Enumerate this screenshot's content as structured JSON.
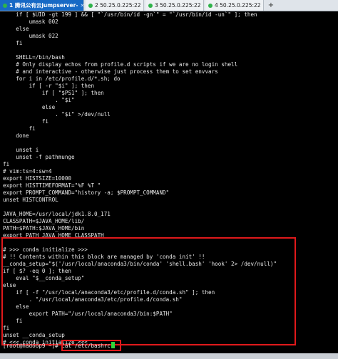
{
  "tabs": [
    {
      "label": "1 腾讯公有云jumpserver-",
      "active": true
    },
    {
      "label": "2 50.25.0.225:22",
      "active": false
    },
    {
      "label": "3 50.25.0.225:22",
      "active": false
    },
    {
      "label": "4 50.25.0.225:22",
      "active": false
    }
  ],
  "new_tab_label": "+",
  "terminal": {
    "lines": [
      "    if [ $UID -gt 199 ] && [ \"`/usr/bin/id -gn`\" = \"`/usr/bin/id -un`\" ]; then",
      "        umask 002",
      "    else",
      "        umask 022",
      "    fi",
      "",
      "    SHELL=/bin/bash",
      "    # Only display echos from profile.d scripts if we are no login shell",
      "    # and interactive - otherwise just process them to set envvars",
      "    for i in /etc/profile.d/*.sh; do",
      "        if [ -r \"$i\" ]; then",
      "            if [ \"$PS1\" ]; then",
      "                . \"$i\"",
      "            else",
      "                . \"$i\" >/dev/null",
      "            fi",
      "        fi",
      "    done",
      "",
      "    unset i",
      "    unset -f pathmunge",
      "fi",
      "# vim:ts=4:sw=4",
      "export HISTSIZE=10000",
      "export HISTTIMEFORMAT=\"%F %T \"",
      "export PROMPT_COMMAND=\"history -a; $PROMPT_COMMAND\"",
      "unset HISTCONTROL",
      "",
      "JAVA_HOME=/usr/local/jdk1.8.0_171",
      "CLASSPATH=$JAVA_HOME/lib/",
      "PATH=$PATH:$JAVA_HOME/bin",
      "export PATH JAVA_HOME CLASSPATH",
      "",
      "# >>> conda initialize >>>",
      "# !! Contents within this block are managed by 'conda init' !!",
      "__conda_setup=\"$('/usr/local/anaconda3/bin/conda' 'shell.bash' 'hook' 2> /dev/null)\"",
      "if [ $? -eq 0 ]; then",
      "    eval \"$__conda_setup\"",
      "else",
      "    if [ -f \"/usr/local/anaconda3/etc/profile.d/conda.sh\" ]; then",
      "        . \"/usr/local/anaconda3/etc/profile.d/conda.sh\"",
      "    else",
      "        export PATH=\"/usr/local/anaconda3/bin:$PATH\"",
      "    fi",
      "fi",
      "unset __conda_setup",
      "# <<< conda initialize <<<"
    ],
    "prompt": "[root@hadoop9 ~]# ",
    "command": "cat /etc/bashrc"
  },
  "colors": {
    "active_tab": "#1769c5",
    "highlight_border": "#e0191b",
    "cursor": "#2fd43a",
    "terminal_bg": "#000000",
    "terminal_fg": "#e8e8e8"
  }
}
